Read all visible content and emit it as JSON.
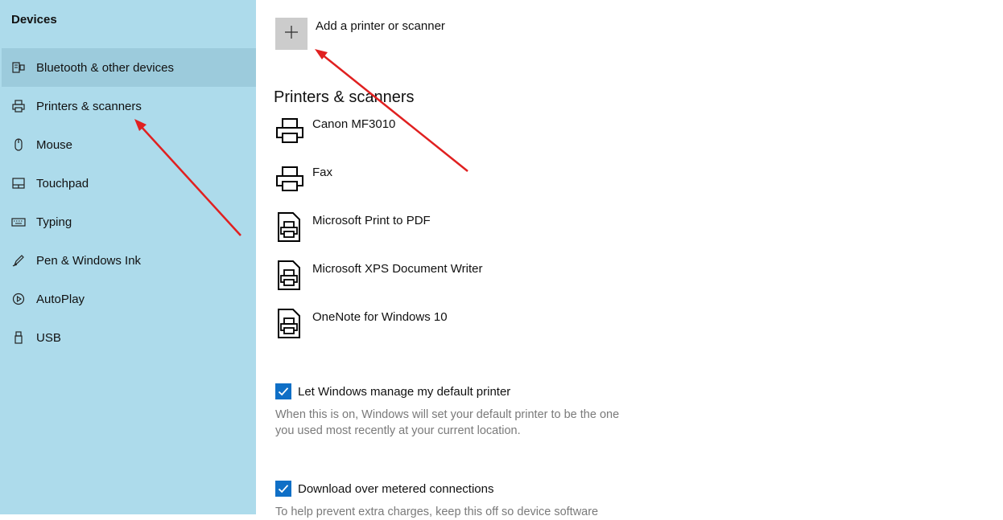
{
  "sidebar": {
    "title": "Devices",
    "items": [
      {
        "label": "Bluetooth & other devices",
        "icon": "bluetooth-devices-icon",
        "selected": true
      },
      {
        "label": "Printers & scanners",
        "icon": "printer-icon",
        "selected": false
      },
      {
        "label": "Mouse",
        "icon": "mouse-icon",
        "selected": false
      },
      {
        "label": "Touchpad",
        "icon": "touchpad-icon",
        "selected": false
      },
      {
        "label": "Typing",
        "icon": "keyboard-icon",
        "selected": false
      },
      {
        "label": "Pen & Windows Ink",
        "icon": "pen-icon",
        "selected": false
      },
      {
        "label": "AutoPlay",
        "icon": "autoplay-icon",
        "selected": false
      },
      {
        "label": "USB",
        "icon": "usb-icon",
        "selected": false
      }
    ]
  },
  "main": {
    "add_label": "Add a printer or scanner",
    "section_title": "Printers & scanners",
    "devices": [
      {
        "name": "Canon MF3010",
        "icon": "printer-icon"
      },
      {
        "name": "Fax",
        "icon": "printer-icon"
      },
      {
        "name": "Microsoft Print to PDF",
        "icon": "document-printer-icon"
      },
      {
        "name": "Microsoft XPS Document Writer",
        "icon": "document-printer-icon"
      },
      {
        "name": "OneNote for Windows 10",
        "icon": "document-printer-icon"
      }
    ],
    "options": [
      {
        "label": "Let Windows manage my default printer",
        "checked": true,
        "description_lines": [
          "When this is on, Windows will set your default printer to be the one",
          "you used most recently at your current location."
        ]
      },
      {
        "label": "Download over metered connections",
        "checked": true,
        "description_lines": [
          "To help prevent extra charges, keep this off so device software"
        ]
      }
    ]
  },
  "colors": {
    "sidebar_bg": "#addbeb",
    "sidebar_selected": "#9ccbdc",
    "checkbox": "#0f6fc6",
    "annotation_arrow": "#e02020"
  }
}
